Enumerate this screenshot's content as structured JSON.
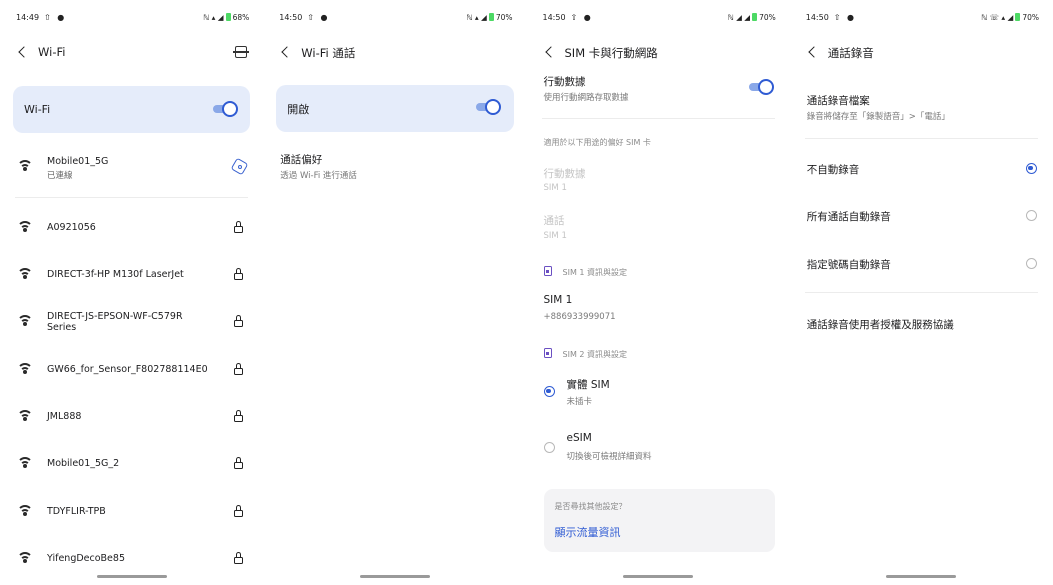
{
  "screens": [
    {
      "status": {
        "time": "14:49",
        "battery": "68%"
      },
      "title": "Wi-Fi",
      "master_toggle": {
        "label": "Wi-Fi",
        "on": true
      },
      "connected": {
        "ssid": "Mobile01_5G",
        "status": "已連線"
      },
      "networks": [
        "A0921056",
        "DIRECT-3f-HP M130f LaserJet",
        "DIRECT-JS-EPSON-WF-C579R Series",
        "GW66_for_Sensor_F802788114E0",
        "JML888",
        "Mobile01_5G_2",
        "TDYFLIR-TPB",
        "YifengDecoBe85"
      ]
    },
    {
      "status": {
        "time": "14:50",
        "battery": "70%"
      },
      "title": "Wi-Fi 通話",
      "master_toggle": {
        "label": "開啟",
        "on": true
      },
      "pref": {
        "title": "通話偏好",
        "subtitle": "透過 Wi-Fi 進行通話"
      }
    },
    {
      "status": {
        "time": "14:50",
        "battery": "70%"
      },
      "title": "SIM 卡與行動網路",
      "mobile_data": {
        "title": "行動數據",
        "subtitle": "使用行動網路存取數據",
        "on": true
      },
      "preferred_label": "適用於以下用途的偏好 SIM 卡",
      "pref_data": {
        "title": "行動數據",
        "value": "SIM 1"
      },
      "pref_call": {
        "title": "通話",
        "value": "SIM 1"
      },
      "sim1_section": "SIM 1 資訊與設定",
      "sim1": {
        "name": "SIM 1",
        "number": "+886933999071"
      },
      "sim2_section": "SIM 2 資訊與設定",
      "sim2_options": [
        {
          "title": "實體 SIM",
          "subtitle": "未插卡",
          "selected": true
        },
        {
          "title": "eSIM",
          "subtitle": "切換後可檢視詳細資料",
          "selected": false
        }
      ],
      "info_card": {
        "question": "是否尋找其他設定？",
        "link": "顯示流量資訊"
      }
    },
    {
      "status": {
        "time": "14:50",
        "battery": "70%"
      },
      "title": "通話錄音",
      "files": {
        "title": "通話錄音檔案",
        "subtitle": "錄音將儲存至「錄製語音」>「電話」"
      },
      "options": [
        {
          "label": "不自動錄音",
          "selected": true
        },
        {
          "label": "所有通話自動錄音",
          "selected": false
        },
        {
          "label": "指定號碼自動錄音",
          "selected": false
        }
      ],
      "agreement": "通話錄音使用者授權及服務協議"
    }
  ],
  "colors": {
    "accent": "#2f5bd3",
    "card_bg": "#e5ecfa",
    "secondary_text": "#7a7a7a"
  },
  "icons": [
    "back-arrow-icon",
    "scan-icon",
    "wifi-signal-icon",
    "lock-icon",
    "gear-icon",
    "sim-card-icon",
    "radio-icon",
    "toggle-switch"
  ]
}
